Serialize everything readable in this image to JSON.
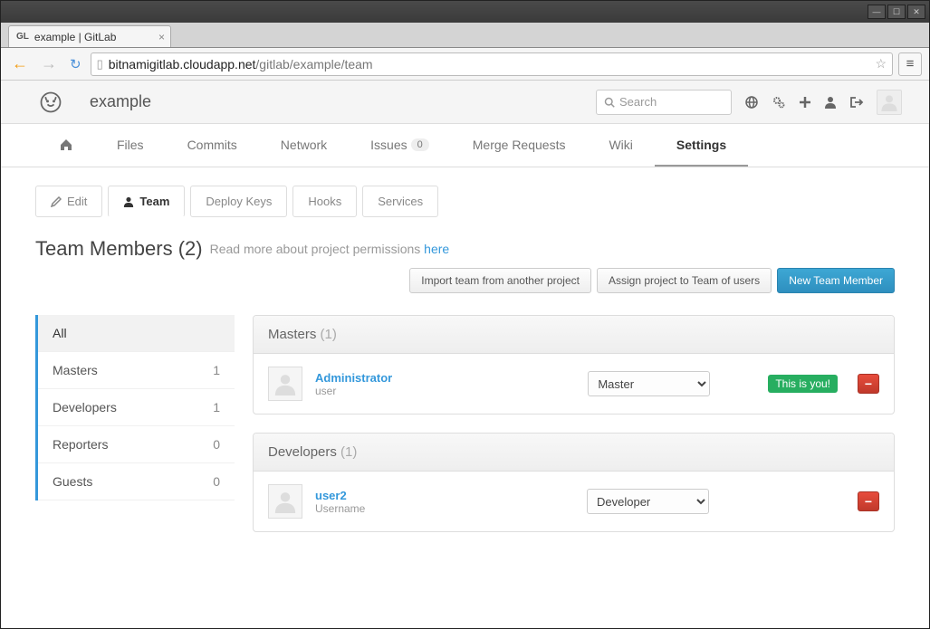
{
  "window": {
    "tab_favicon": "GL",
    "tab_title": "example | GitLab"
  },
  "url": {
    "host": "bitnamigitlab.cloudapp.net",
    "path": "/gitlab/example/team"
  },
  "header": {
    "project": "example",
    "search_placeholder": "Search"
  },
  "nav": {
    "files": "Files",
    "commits": "Commits",
    "network": "Network",
    "issues": "Issues",
    "issues_count": "0",
    "merge": "Merge Requests",
    "wiki": "Wiki",
    "settings": "Settings"
  },
  "subnav": {
    "edit": "Edit",
    "team": "Team",
    "deploy": "Deploy Keys",
    "hooks": "Hooks",
    "services": "Services"
  },
  "heading": {
    "title": "Team Members (2)",
    "subtext": "Read more about project permissions ",
    "link": "here"
  },
  "actions": {
    "import": "Import team from another project",
    "assign": "Assign project to Team of users",
    "new": "New Team Member"
  },
  "sidebar": {
    "all": {
      "label": "All"
    },
    "masters": {
      "label": "Masters",
      "count": "1"
    },
    "developers": {
      "label": "Developers",
      "count": "1"
    },
    "reporters": {
      "label": "Reporters",
      "count": "0"
    },
    "guests": {
      "label": "Guests",
      "count": "0"
    }
  },
  "groups": {
    "masters": {
      "title": "Masters",
      "count": "(1)",
      "member": {
        "name": "Administrator",
        "sub": "user",
        "role": "Master",
        "you": "This is you!"
      }
    },
    "developers": {
      "title": "Developers",
      "count": "(1)",
      "member": {
        "name": "user2",
        "sub": "Username",
        "role": "Developer"
      }
    }
  }
}
